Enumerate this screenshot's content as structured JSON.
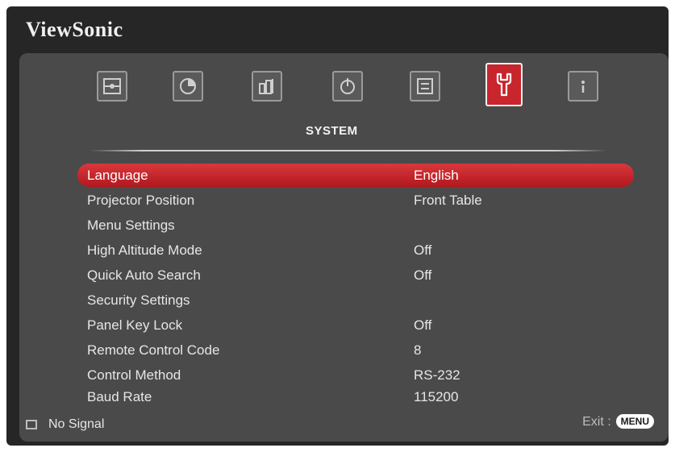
{
  "brand": "ViewSonic",
  "section_title": "SYSTEM",
  "tabs": [
    {
      "icon": "picture-icon"
    },
    {
      "icon": "color-icon"
    },
    {
      "icon": "image-settings-icon"
    },
    {
      "icon": "power-icon"
    },
    {
      "icon": "basic-icon"
    },
    {
      "icon": "system-wrench-icon"
    },
    {
      "icon": "information-icon"
    }
  ],
  "menu": {
    "items": [
      {
        "label": "Language",
        "value": "English"
      },
      {
        "label": "Projector Position",
        "value": "Front Table"
      },
      {
        "label": "Menu Settings",
        "value": ""
      },
      {
        "label": "High Altitude Mode",
        "value": "Off"
      },
      {
        "label": "Quick Auto Search",
        "value": "Off"
      },
      {
        "label": "Security Settings",
        "value": ""
      },
      {
        "label": "Panel Key Lock",
        "value": "Off"
      },
      {
        "label": "Remote Control Code",
        "value": "8"
      },
      {
        "label": "Control Method",
        "value": "RS-232"
      },
      {
        "label": "Baud Rate",
        "value": "115200"
      }
    ]
  },
  "status": {
    "signal": "No Signal"
  },
  "exit": {
    "label": "Exit :",
    "key": "MENU"
  },
  "colors": {
    "accent": "#c8252c",
    "panel": "#4a4a4a",
    "frame": "#262626"
  }
}
